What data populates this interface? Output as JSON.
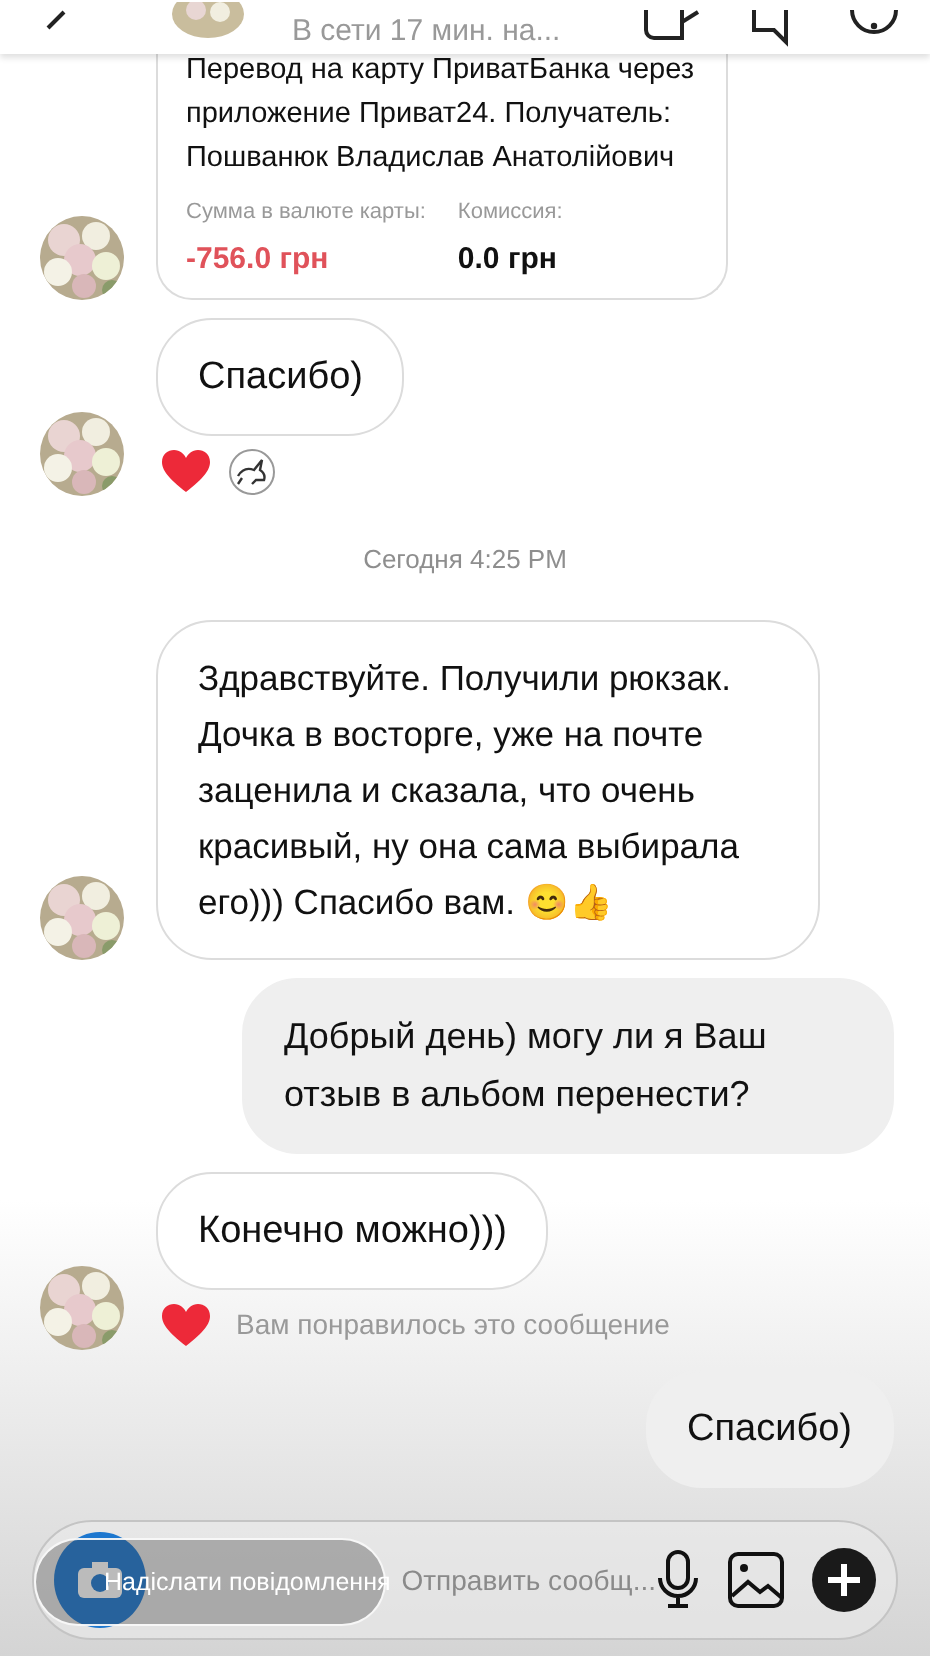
{
  "header": {
    "status": "В сети 17 мин. на..."
  },
  "messages": [
    {
      "kind": "transfer",
      "avatar": true,
      "lines": [
        "Перевод на карту ПриватБанка через",
        "приложение Приват24. Получатель:",
        "Пошванюк Владислав Анатолійович"
      ],
      "fields": [
        {
          "label": "Сумма в валюте карты:",
          "value": "-756.0 грн",
          "color": "#e0525a"
        },
        {
          "label": "Комиссия:",
          "value": "0.0 грн",
          "color": "#111111"
        }
      ]
    },
    {
      "kind": "incoming",
      "avatar": true,
      "text": "Спасибо)",
      "reactions": [
        {
          "kind": "heart"
        },
        {
          "kind": "sticker"
        }
      ]
    },
    {
      "kind": "time",
      "text": "Сегодня 4:25 PM"
    },
    {
      "kind": "incoming",
      "avatar": true,
      "text": "Здравствуйте. Получили рюкзак. Дочка в восторге, уже на почте заценила и сказала, что очень красивый, ну она сама выбирала его))) Спасибо вам. 😊👍"
    },
    {
      "kind": "outgoing",
      "avatar": false,
      "text": "Добрый день) могу ли я Ваш отзыв в альбом перенести?"
    },
    {
      "kind": "incoming",
      "avatar": true,
      "text": "Конечно можно)))",
      "reactions": [
        {
          "kind": "heart"
        }
      ],
      "reaction_note": "Вам понравилось это сообщение"
    },
    {
      "kind": "outgoing",
      "avatar": false,
      "text": "Спасибо)"
    }
  ],
  "composer": {
    "overlay_text": "Надіслати повідомлення",
    "placeholder": "Отправить сообщ..."
  }
}
